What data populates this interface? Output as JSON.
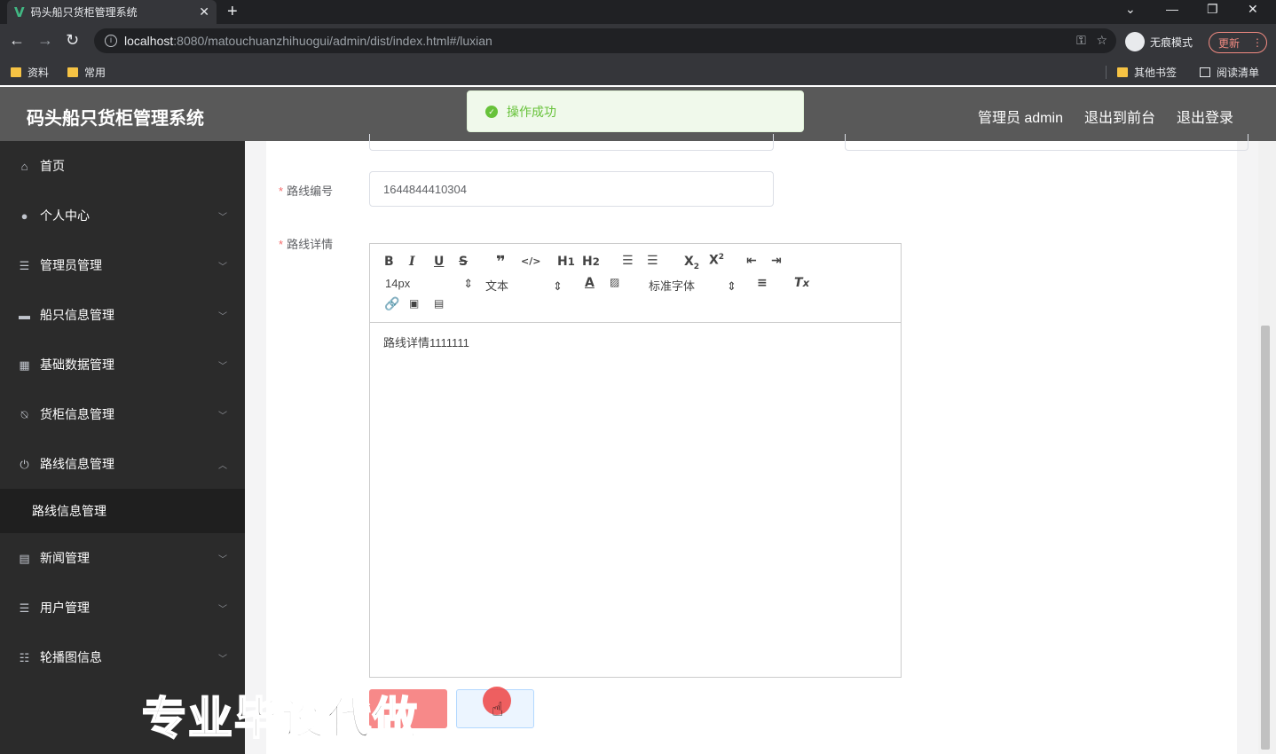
{
  "browser": {
    "tab_title": "码头船只货柜管理系统",
    "url_host": "localhost",
    "url_rest": ":8080/matouchuanzhihuogui/admin/dist/index.html#/luxian",
    "incognito_label": "无痕模式",
    "update_label": "更新",
    "bookmarks": [
      "资料",
      "常用"
    ],
    "other_bookmarks": "其他书签",
    "reading_list": "阅读清单"
  },
  "header": {
    "title": "码头船只货柜管理系统",
    "user": "管理员 admin",
    "front_link": "退出到前台",
    "logout_link": "退出登录"
  },
  "toast": {
    "message": "操作成功"
  },
  "sidebar": {
    "items": [
      {
        "label": "首页",
        "icon": "home-icon"
      },
      {
        "label": "个人中心",
        "icon": "user-icon"
      },
      {
        "label": "管理员管理",
        "icon": "list-icon"
      },
      {
        "label": "船只信息管理",
        "icon": "ship-icon"
      },
      {
        "label": "基础数据管理",
        "icon": "grid-icon"
      },
      {
        "label": "货柜信息管理",
        "icon": "bell-icon"
      },
      {
        "label": "路线信息管理",
        "icon": "power-icon"
      },
      {
        "label": "新闻管理",
        "icon": "doc-icon"
      },
      {
        "label": "用户管理",
        "icon": "list-icon"
      },
      {
        "label": "轮播图信息",
        "icon": "sliders-icon"
      }
    ],
    "submenu": "路线信息管理"
  },
  "form": {
    "route_no_label": "路线编号",
    "route_no_value": "1644844410304",
    "route_detail_label": "路线详情",
    "editor_content": "路线详情1111111",
    "font_size": "14px",
    "text_type": "文本",
    "font_family": "标准字体"
  },
  "watermark": "专业毕设代做"
}
